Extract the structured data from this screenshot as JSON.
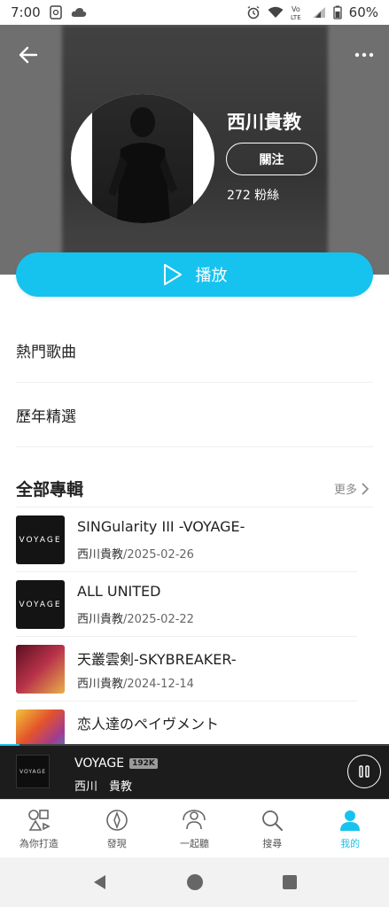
{
  "status": {
    "time": "7:00",
    "battery": "60%"
  },
  "artist": {
    "name": "西川貴教",
    "follow_label": "關注",
    "fans": "272 粉絲"
  },
  "play_label": "播放",
  "menu": {
    "hot_songs": "熱門歌曲",
    "yearly_picks": "歷年精選"
  },
  "albums_section": {
    "title": "全部專輯",
    "more_label": "更多"
  },
  "albums": [
    {
      "title": "SINGularity III -VOYAGE-",
      "artist": "西川貴教",
      "date": "/2025-02-26",
      "cover_text": "VOYAGE"
    },
    {
      "title": "ALL UNITED",
      "artist": "西川貴教",
      "date": "/2025-02-22",
      "cover_text": "VOYAGE"
    },
    {
      "title": "天叢雲剣-SKYBREAKER-",
      "artist": "西川貴教",
      "date": "/2024-12-14",
      "cover_text": ""
    },
    {
      "title": "恋人達のペイヴメント",
      "artist": "",
      "date": "",
      "cover_text": ""
    }
  ],
  "mini_player": {
    "title": "VOYAGE",
    "quality": "192K",
    "artist": "西川　貴教",
    "cover_text": "VOYAGE",
    "progress": 0.05
  },
  "nav": [
    {
      "label": "為你打造",
      "icon": "for-you-icon"
    },
    {
      "label": "發現",
      "icon": "compass-icon"
    },
    {
      "label": "一起聽",
      "icon": "listen-together-icon"
    },
    {
      "label": "搜尋",
      "icon": "search-icon"
    },
    {
      "label": "我的",
      "icon": "profile-icon"
    }
  ],
  "colors": {
    "accent": "#16c3ee",
    "header_bg": "#6f6f6f",
    "player_bg": "#1c1c1c"
  }
}
